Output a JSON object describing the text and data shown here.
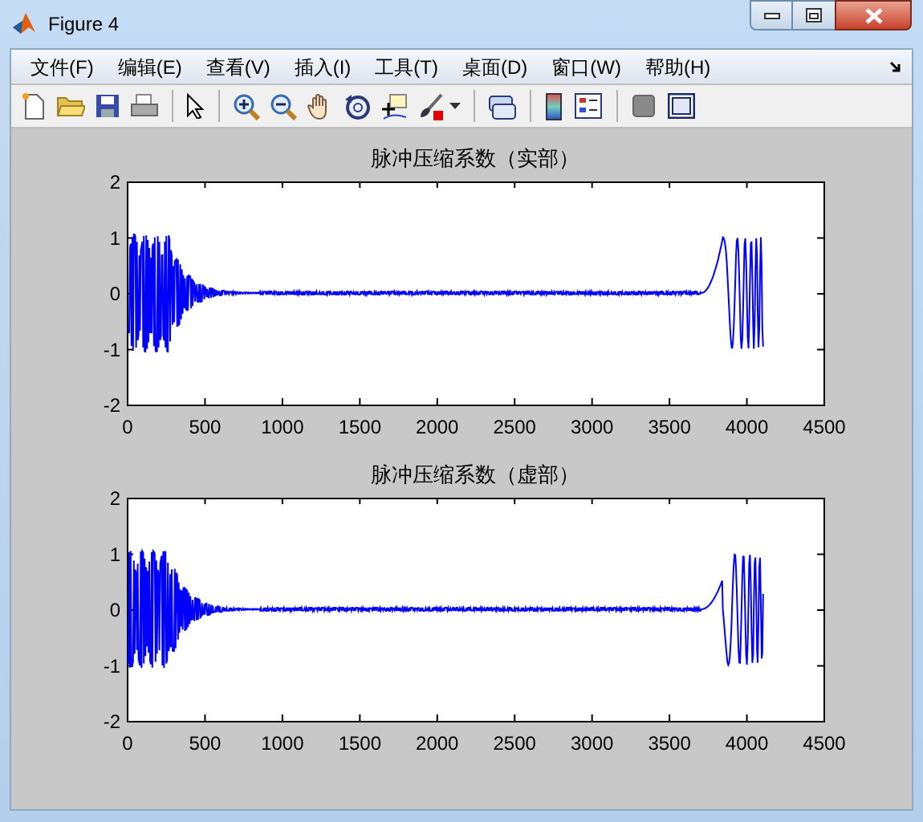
{
  "window": {
    "title": "Figure 4"
  },
  "menus": [
    "文件(F)",
    "编辑(E)",
    "查看(V)",
    "插入(I)",
    "工具(T)",
    "桌面(D)",
    "窗口(W)",
    "帮助(H)"
  ],
  "plots": [
    {
      "title": "脉冲压缩系数（实部）",
      "xticks": [
        "0",
        "500",
        "1000",
        "1500",
        "2000",
        "2500",
        "3000",
        "3500",
        "4000",
        "4500"
      ],
      "yticks": [
        "2",
        "1",
        "0",
        "-1",
        "-2"
      ]
    },
    {
      "title": "脉冲压缩系数（虚部）",
      "xticks": [
        "0",
        "500",
        "1000",
        "1500",
        "2000",
        "2500",
        "3000",
        "3500",
        "4000",
        "4500"
      ],
      "yticks": [
        "2",
        "1",
        "0",
        "-1",
        "-2"
      ]
    }
  ]
}
